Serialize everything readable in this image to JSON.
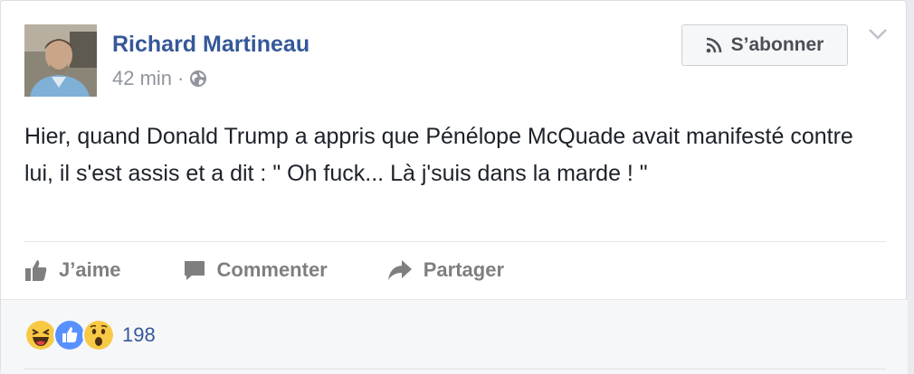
{
  "post": {
    "author": "Richard Martineau",
    "time": "42 min",
    "separator": "·",
    "privacy_icon": "globe-icon",
    "subscribe_label": "S’abonner",
    "text": "Hier, quand Donald Trump a appris que Pénélope McQuade avait manifesté contre lui, il s'est assis et a dit : \" Oh fuck... Là j'suis dans la marde ! \""
  },
  "actions": {
    "like_label": "J’aime",
    "comment_label": "Commenter",
    "share_label": "Partager"
  },
  "reactions": {
    "icons": [
      "haha-icon",
      "like-icon",
      "wow-icon"
    ],
    "count": "198"
  },
  "colors": {
    "link": "#365899",
    "muted": "#90949c",
    "like_blue": "#5890ff",
    "emoji_yellow": "#f7c945"
  }
}
